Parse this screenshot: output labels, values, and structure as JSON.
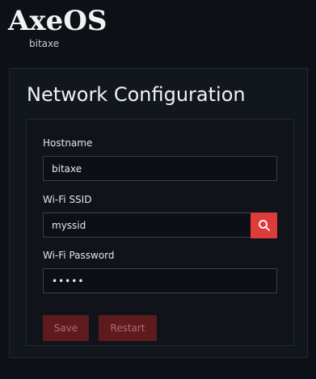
{
  "brand": {
    "logo_text": "AxeOS",
    "sub_label": "bitaxe"
  },
  "page": {
    "title": "Network Configuration"
  },
  "form": {
    "hostname": {
      "label": "Hostname",
      "value": "bitaxe"
    },
    "ssid": {
      "label": "Wi-Fi SSID",
      "value": "myssid",
      "search_icon": "search-icon"
    },
    "password": {
      "label": "Wi-Fi Password",
      "value": "•••••"
    },
    "buttons": {
      "save_label": "Save",
      "restart_label": "Restart"
    }
  },
  "colors": {
    "background": "#0d1117",
    "accent": "#e03b3b",
    "disabled_button": "#5e1b1d"
  }
}
